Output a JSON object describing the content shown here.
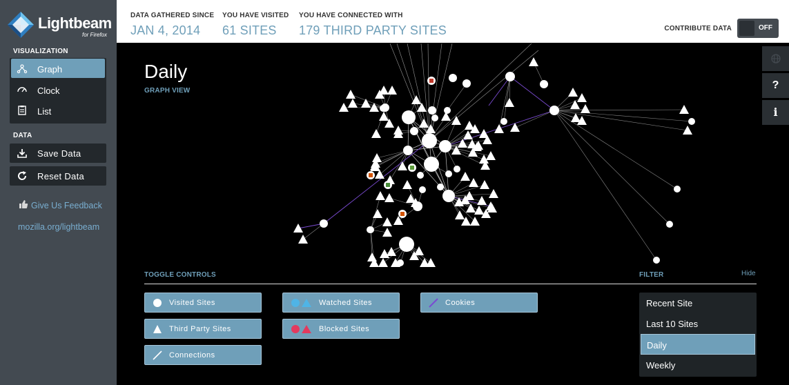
{
  "app": {
    "name": "Lightbeam",
    "subtitle": "for Firefox"
  },
  "sidebar": {
    "visualization_heading": "VISUALIZATION",
    "viz_items": [
      {
        "label": "Graph",
        "icon": "graph-icon",
        "active": true
      },
      {
        "label": "Clock",
        "icon": "clock-icon",
        "active": false
      },
      {
        "label": "List",
        "icon": "list-icon",
        "active": false
      }
    ],
    "data_heading": "DATA",
    "save_label": "Save Data",
    "reset_label": "Reset Data",
    "feedback_label": "Give Us Feedback",
    "mozilla_link": "mozilla.org/lightbeam"
  },
  "stats": {
    "gathered_label": "DATA GATHERED SINCE",
    "gathered_value": "JAN 4, 2014",
    "visited_label": "YOU HAVE VISITED",
    "visited_value": "61 SITES",
    "connected_label": "YOU HAVE CONNECTED WITH",
    "connected_value": "179 THIRD PARTY SITES"
  },
  "contribute": {
    "label": "CONTRIBUTE DATA",
    "state": "OFF"
  },
  "right_icons": [
    "globe-icon",
    "help-icon",
    "info-icon"
  ],
  "view": {
    "title": "Daily",
    "subtitle": "GRAPH VIEW"
  },
  "toggle_controls": {
    "heading": "TOGGLE CONTROLS",
    "visited": "Visited Sites",
    "watched": "Watched Sites",
    "cookies": "Cookies",
    "third_party": "Third Party Sites",
    "blocked": "Blocked Sites",
    "connections": "Connections"
  },
  "filter": {
    "heading": "FILTER",
    "hide_label": "Hide",
    "options": [
      "Recent Site",
      "Last 10 Sites",
      "Daily",
      "Weekly"
    ],
    "selected": "Daily"
  },
  "colors": {
    "accent": "#6f9fb9",
    "sidebar": "#434a51",
    "watched": "#4fb4e6",
    "blocked": "#e23a5e",
    "cookies": "#7a4bd1"
  }
}
